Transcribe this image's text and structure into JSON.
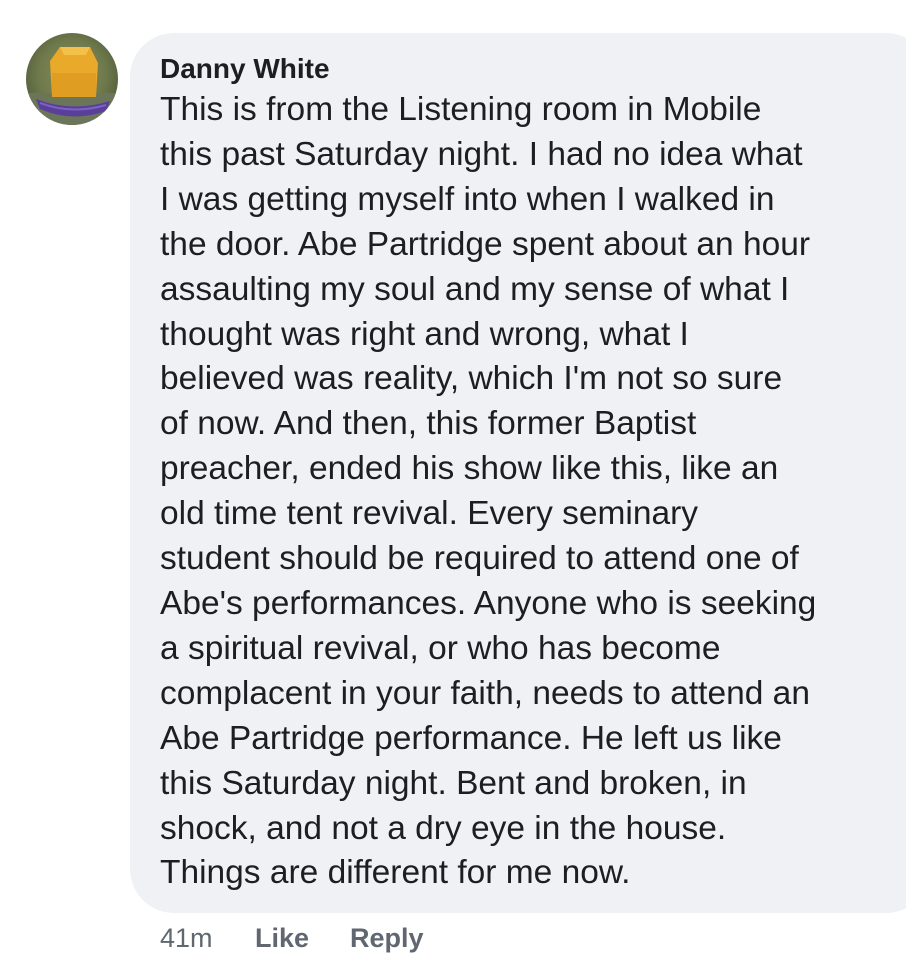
{
  "comment": {
    "author": "Danny White",
    "avatar_icon": "profile-photo-boat-icon",
    "bubble_color": "#f0f1f4",
    "text_lines": [
      "This is from the Listening room in Mobile",
      "this past Saturday night. I had no idea what",
      "I was getting myself into when I walked in",
      "the door. Abe Partridge spent about an hour",
      "assaulting my soul and my sense of what I",
      "thought was right and wrong, what I",
      "believed was reality, which I'm not so sure",
      "of now. And then, this former Baptist",
      "preacher, ended his show like this, like an",
      "old time tent revival. Every seminary",
      "student should be required to attend one of",
      "Abe's performances. Anyone who is seeking",
      "a spiritual revival, or who has become",
      "complacent in your faith, needs to attend an",
      "Abe Partridge performance. He left us like",
      "this Saturday night. Bent and broken, in",
      "shock, and not a dry eye in the house.",
      "Things are different for me now."
    ]
  },
  "meta": {
    "timestamp": "41m",
    "like_label": "Like",
    "reply_label": "Reply"
  }
}
